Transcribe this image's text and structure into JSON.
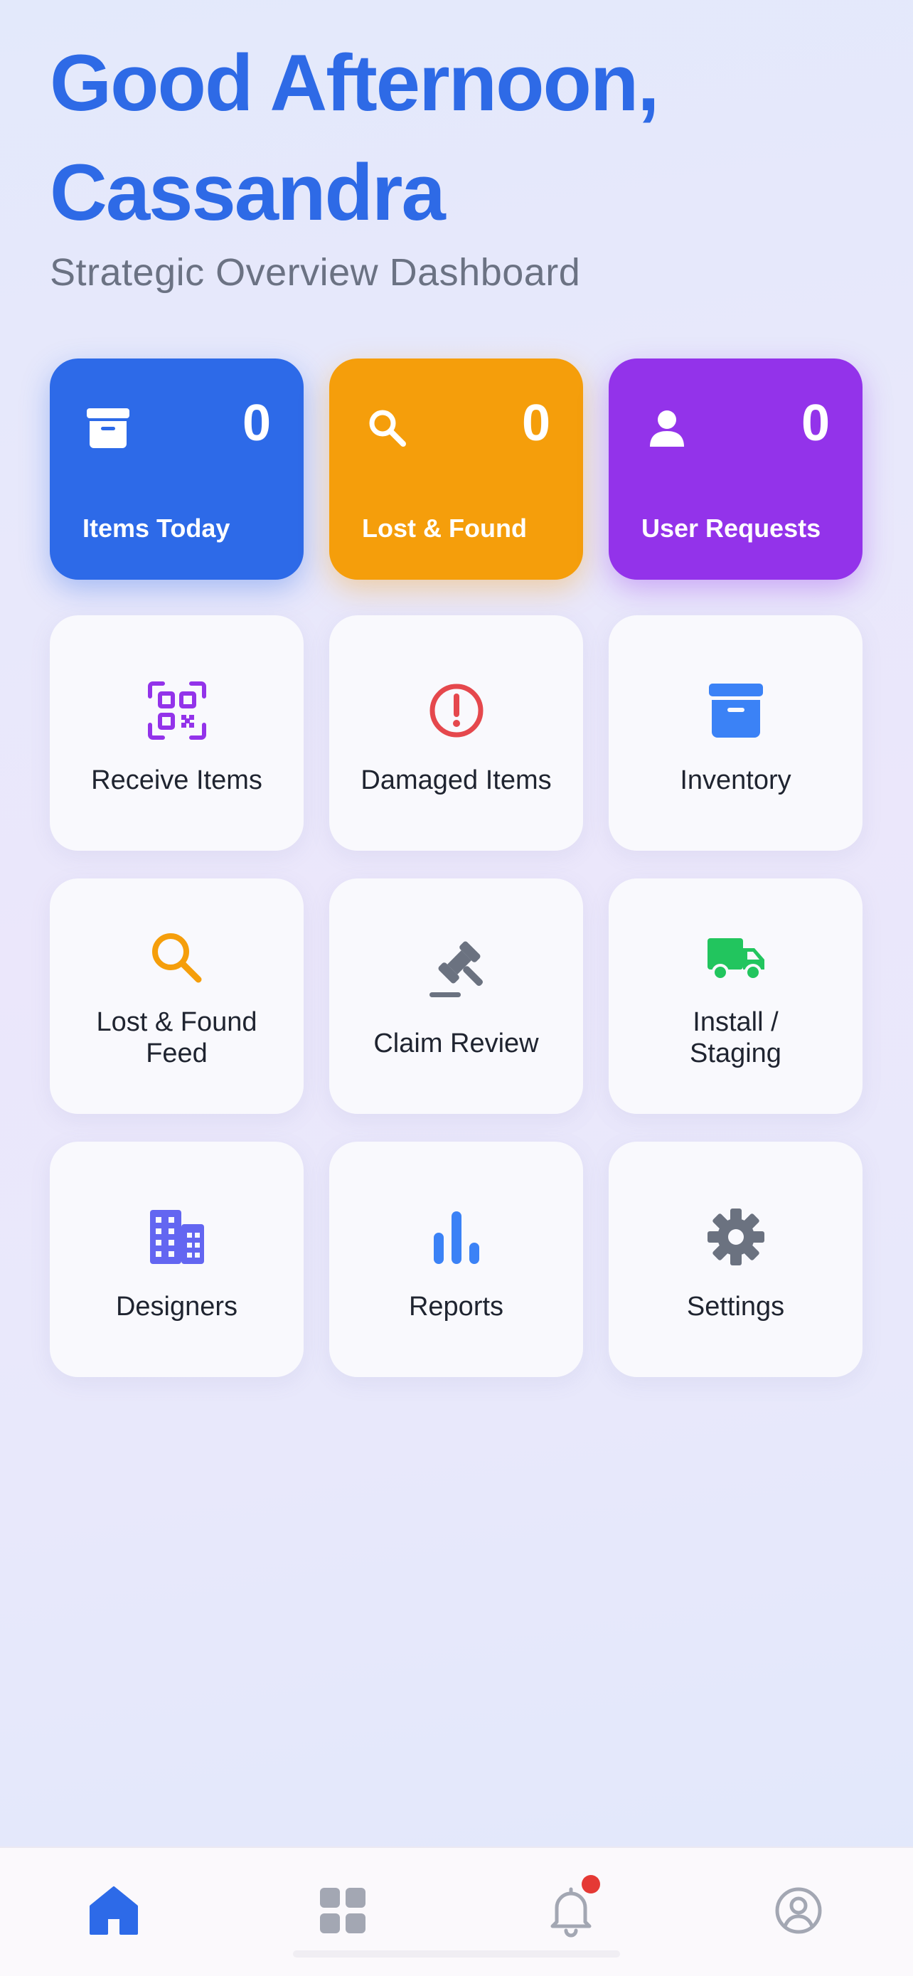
{
  "header": {
    "greeting_line1": "Good Afternoon,",
    "greeting_line2": "Cassandra",
    "subtitle": "Strategic Overview Dashboard"
  },
  "stats": [
    {
      "label": "Items Today",
      "count": "0",
      "icon": "archive-icon",
      "color": "#2d6ae8"
    },
    {
      "label": "Lost & Found",
      "count": "0",
      "icon": "search-icon",
      "color": "#f59e0b"
    },
    {
      "label": "User Requests",
      "count": "0",
      "icon": "user-icon",
      "color": "#9333ea"
    }
  ],
  "tiles": [
    {
      "label": "Receive Items",
      "icon": "qr-code-icon",
      "color": "#9333ea"
    },
    {
      "label": "Damaged Items",
      "icon": "alert-circle-icon",
      "color": "#e5484d"
    },
    {
      "label": "Inventory",
      "icon": "archive-icon",
      "color": "#3b82f6"
    },
    {
      "label_line1": "Lost & Found",
      "label_line2": "Feed",
      "icon": "search-icon",
      "color": "#f59e0b"
    },
    {
      "label": "Claim Review",
      "icon": "gavel-icon",
      "color": "#6b7280"
    },
    {
      "label_line1": "Install /",
      "label_line2": "Staging",
      "icon": "truck-icon",
      "color": "#22c55e"
    },
    {
      "label": "Designers",
      "icon": "building-icon",
      "color": "#6366f1"
    },
    {
      "label": "Reports",
      "icon": "bar-chart-icon",
      "color": "#3b82f6"
    },
    {
      "label": "Settings",
      "icon": "gear-icon",
      "color": "#6b7280"
    }
  ],
  "bottom_nav": [
    {
      "icon": "home-icon",
      "active": true,
      "color": "#2d6ae8"
    },
    {
      "icon": "grid-icon",
      "active": false,
      "color": "#a3a7b3"
    },
    {
      "icon": "bell-icon",
      "active": false,
      "color": "#a3a7b3",
      "badge_color": "#e53935"
    },
    {
      "icon": "profile-icon",
      "active": false,
      "color": "#a3a7b3"
    }
  ]
}
